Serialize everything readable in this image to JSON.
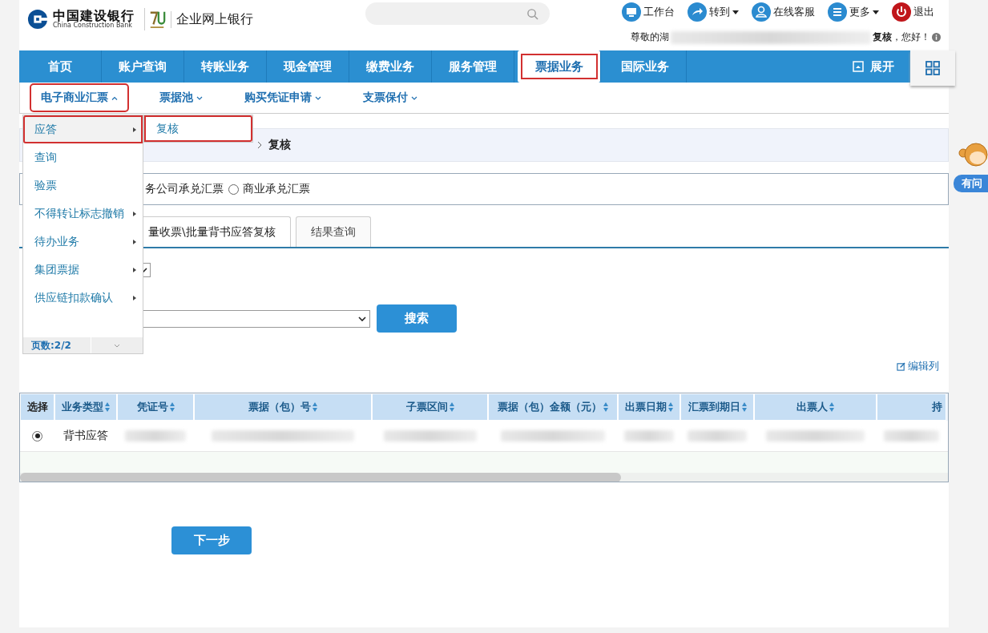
{
  "header": {
    "logo_cn": "中国建设银行",
    "logo_en": "China Construction Bank",
    "product": "企业网上银行",
    "top_links": [
      {
        "label": "工作台",
        "kind": "desk",
        "caret": false
      },
      {
        "label": "转到",
        "kind": "goto",
        "caret": true
      },
      {
        "label": "在线客服",
        "kind": "service",
        "caret": false
      },
      {
        "label": "更多",
        "kind": "more",
        "caret": true
      },
      {
        "label": "退出",
        "kind": "logout",
        "caret": false
      }
    ],
    "greeting_start": "尊敬的湖",
    "greeting_end": "**复核**，您好！"
  },
  "nav": {
    "items": [
      {
        "label": "首页",
        "selected": false,
        "highlighted": false
      },
      {
        "label": "账户查询",
        "selected": false,
        "highlighted": false
      },
      {
        "label": "转账业务",
        "selected": false,
        "highlighted": false
      },
      {
        "label": "现金管理",
        "selected": false,
        "highlighted": false
      },
      {
        "label": "缴费业务",
        "selected": false,
        "highlighted": false
      },
      {
        "label": "服务管理",
        "selected": false,
        "highlighted": false
      },
      {
        "label": "票据业务",
        "selected": true,
        "highlighted": true
      },
      {
        "label": "国际业务",
        "selected": false,
        "highlighted": false
      }
    ],
    "expand": "展开"
  },
  "subnav": [
    {
      "label": "电子商业汇票",
      "expanded": true,
      "highlighted": true
    },
    {
      "label": "票据池",
      "expanded": false,
      "highlighted": false
    },
    {
      "label": "购买凭证申请",
      "expanded": false,
      "highlighted": false
    },
    {
      "label": "支票保付",
      "expanded": false,
      "highlighted": false
    }
  ],
  "menu": {
    "items": [
      {
        "label": "应答",
        "has_submenu": true,
        "selected": true,
        "highlighted": true
      },
      {
        "label": "查询",
        "has_submenu": false,
        "selected": false,
        "highlighted": false
      },
      {
        "label": "验票",
        "has_submenu": false,
        "selected": false,
        "highlighted": false
      },
      {
        "label": "不得转让标志撤销",
        "has_submenu": true,
        "selected": false,
        "highlighted": false
      },
      {
        "label": "待办业务",
        "has_submenu": true,
        "selected": false,
        "highlighted": false
      },
      {
        "label": "集团票据",
        "has_submenu": true,
        "selected": false,
        "highlighted": false
      },
      {
        "label": "供应链扣款确认",
        "has_submenu": true,
        "selected": false,
        "highlighted": false
      }
    ],
    "submenu": [
      "复核"
    ],
    "pager": "页数:2/2"
  },
  "breadcrumb": [
    "复核"
  ],
  "filter": {
    "fragment": "务公司承兑汇票",
    "options": [
      {
        "label": "商业承兑汇票",
        "selected": false
      }
    ]
  },
  "tabs": [
    {
      "label": "量收票\\批量背书应答复核",
      "selected": true
    },
    {
      "label": "结果查询",
      "selected": false
    }
  ],
  "search_button": "搜索",
  "edit_columns": "编辑列",
  "table": {
    "columns": [
      {
        "label": "选择",
        "sortable": false
      },
      {
        "label": "业务类型",
        "sortable": true
      },
      {
        "label": "凭证号",
        "sortable": true
      },
      {
        "label": "票据（包）号",
        "sortable": true
      },
      {
        "label": "子票区间",
        "sortable": true
      },
      {
        "label": "票据（包）金额（元）",
        "sortable": true
      },
      {
        "label": "出票日期",
        "sortable": true
      },
      {
        "label": "汇票到期日",
        "sortable": true
      },
      {
        "label": "出票人",
        "sortable": true
      },
      {
        "label": "持",
        "sortable": false
      }
    ],
    "rows": [
      {
        "selected": true,
        "type": "背书应答"
      }
    ]
  },
  "next_button": "下一步",
  "help_badge": "有问"
}
